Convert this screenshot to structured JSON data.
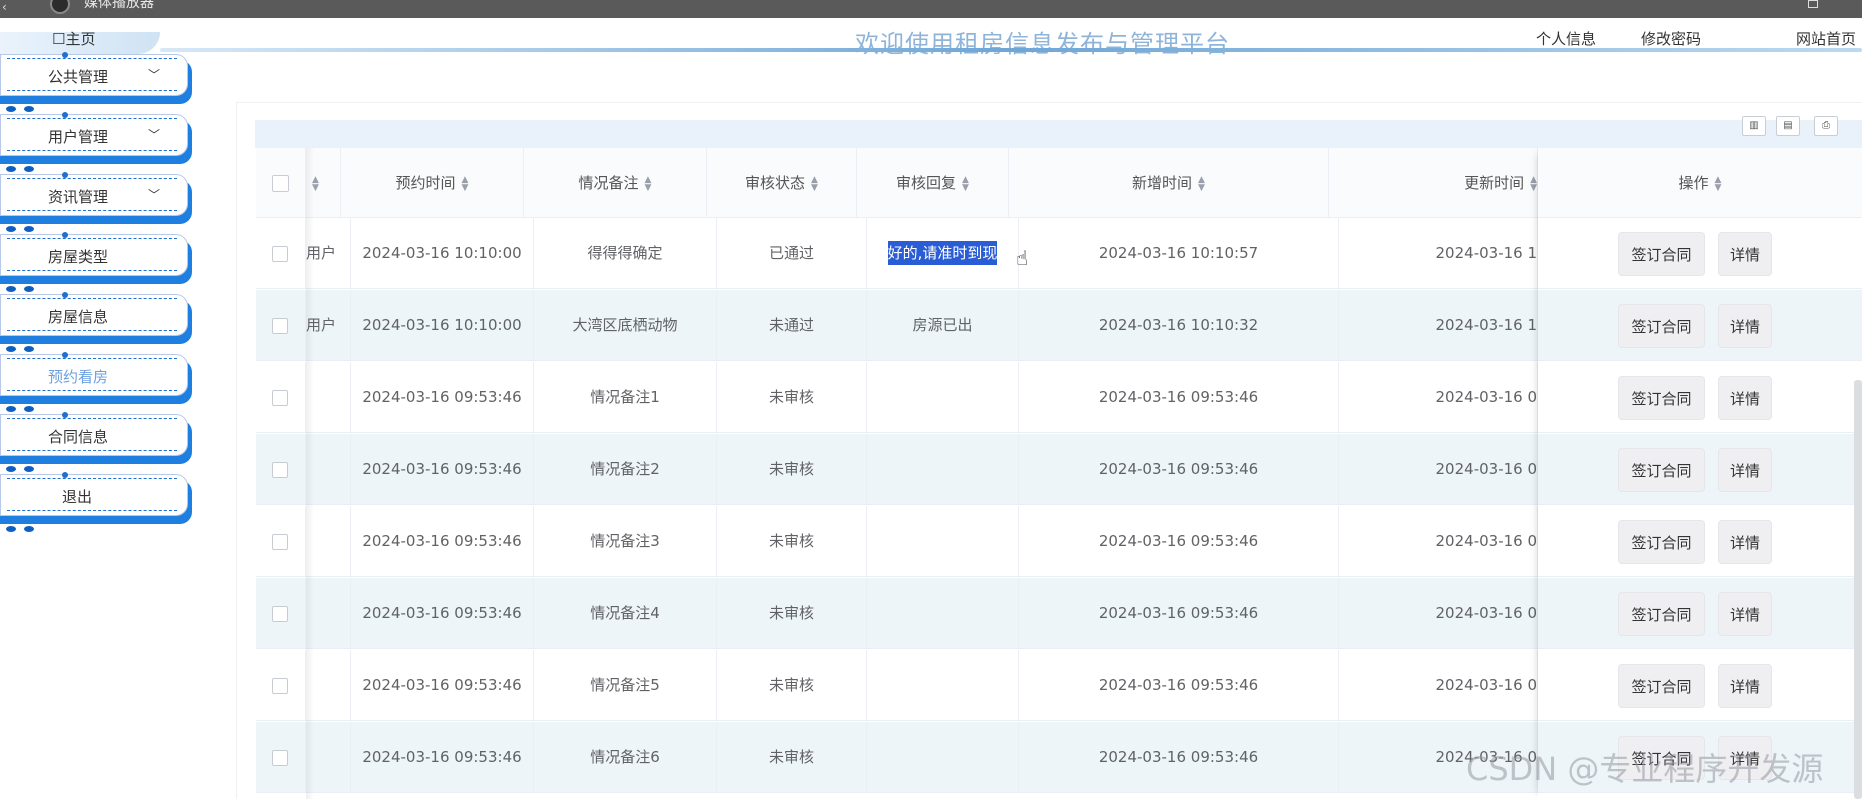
{
  "window": {
    "title": "媒体播放器"
  },
  "header": {
    "home": "☐主页",
    "brand": "欢迎使用租房信息发布与管理平台",
    "nav": [
      "个人信息",
      "修改密码",
      "网站首页"
    ]
  },
  "sidebar": {
    "items": [
      {
        "label": "公共管理",
        "expandable": true
      },
      {
        "label": "用户管理",
        "expandable": true
      },
      {
        "label": "资讯管理",
        "expandable": true
      },
      {
        "label": "房屋类型",
        "expandable": false
      },
      {
        "label": "房屋信息",
        "expandable": false
      },
      {
        "label": "预约看房",
        "expandable": false,
        "active": true
      },
      {
        "label": "合同信息",
        "expandable": false
      },
      {
        "label": "退出",
        "expandable": false
      }
    ],
    "active_color": "#6d9fe0",
    "accent": "#1e7fe0"
  },
  "table": {
    "columns": [
      "",
      "预约时间",
      "情况备注",
      "审核状态",
      "审核回复",
      "新增时间",
      "更新时间",
      "操作"
    ],
    "rows": [
      {
        "user": "用户",
        "time": "2024-03-16 10:10:00",
        "note": "得得得确定",
        "status": "已通过",
        "reply": "好的,请准时到现",
        "created": "2024-03-16 10:10:57",
        "updated": "2024-03-16 1"
      },
      {
        "user": "用户",
        "time": "2024-03-16 10:10:00",
        "note": "大湾区底栖动物",
        "status": "未通过",
        "reply": "房源已出",
        "created": "2024-03-16 10:10:32",
        "updated": "2024-03-16 1"
      },
      {
        "user": "",
        "time": "2024-03-16 09:53:46",
        "note": "情况备注1",
        "status": "未审核",
        "reply": "",
        "created": "2024-03-16 09:53:46",
        "updated": "2024-03-16 0"
      },
      {
        "user": "",
        "time": "2024-03-16 09:53:46",
        "note": "情况备注2",
        "status": "未审核",
        "reply": "",
        "created": "2024-03-16 09:53:46",
        "updated": "2024-03-16 0"
      },
      {
        "user": "",
        "time": "2024-03-16 09:53:46",
        "note": "情况备注3",
        "status": "未审核",
        "reply": "",
        "created": "2024-03-16 09:53:46",
        "updated": "2024-03-16 0"
      },
      {
        "user": "",
        "time": "2024-03-16 09:53:46",
        "note": "情况备注4",
        "status": "未审核",
        "reply": "",
        "created": "2024-03-16 09:53:46",
        "updated": "2024-03-16 0"
      },
      {
        "user": "",
        "time": "2024-03-16 09:53:46",
        "note": "情况备注5",
        "status": "未审核",
        "reply": "",
        "created": "2024-03-16 09:53:46",
        "updated": "2024-03-16 0"
      },
      {
        "user": "",
        "time": "2024-03-16 09:53:46",
        "note": "情况备注6",
        "status": "未审核",
        "reply": "",
        "created": "2024-03-16 09:53:46",
        "updated": "2024-03-16 0"
      }
    ],
    "actions": {
      "contract": "签订合同",
      "detail": "详情"
    },
    "stripe_color": "#eef5f9",
    "highlight_color": "#2a5cd6"
  },
  "toolbar_icons": [
    "columns-icon",
    "export-icon",
    "print-icon"
  ],
  "watermark": "CSDN @专业程序开发源"
}
